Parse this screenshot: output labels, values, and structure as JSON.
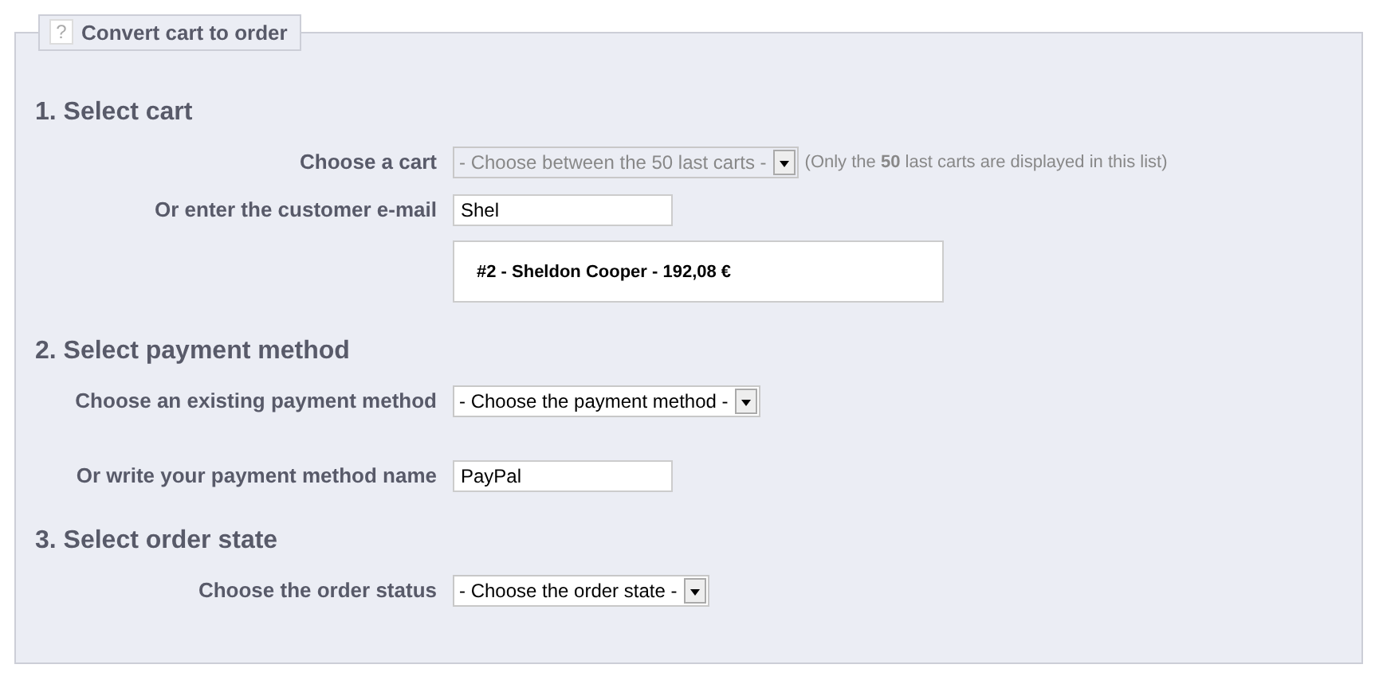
{
  "panel": {
    "help": "?",
    "title": "Convert cart to order"
  },
  "sections": [
    {
      "heading": "1. Select cart",
      "rows": [
        {
          "kind": "select",
          "label": "Choose a cart",
          "value": "- Choose between the 50 last carts -",
          "disabled": true,
          "note": "(Only the **50** last carts are displayed in this list)"
        },
        {
          "kind": "input",
          "label": "Or enter the customer e-mail",
          "value": "Shel"
        },
        {
          "kind": "result",
          "text": "#2 - Sheldon Cooper - 192,08 €"
        }
      ]
    },
    {
      "heading": "2. Select payment method",
      "rows": [
        {
          "kind": "select",
          "label": "Choose an existing payment method",
          "value": "- Choose the payment method -",
          "disabled": false
        },
        {
          "kind": "input",
          "label": "Or write your payment method name",
          "value": "PayPal"
        }
      ]
    },
    {
      "heading": "3. Select order state",
      "rows": [
        {
          "kind": "select",
          "label": "Choose the order status",
          "value": "- Choose the order state -",
          "disabled": false
        }
      ]
    }
  ]
}
